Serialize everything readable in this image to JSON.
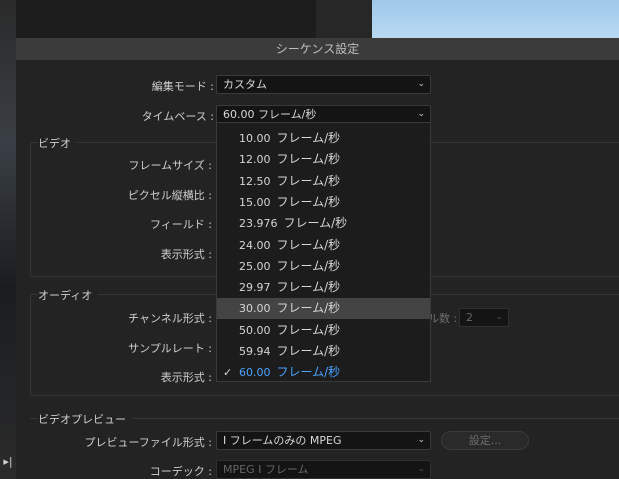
{
  "dialog": {
    "title": "シーケンス設定"
  },
  "edit_mode": {
    "label": "編集モード :",
    "value": "カスタム"
  },
  "timebase": {
    "label": "タイムベース :",
    "value": "60.00  フレーム/秒"
  },
  "video": {
    "title": "ビデオ",
    "frame_size_label": "フレームサイズ :",
    "pixel_aspect_label": "ピクセル縦横比 :",
    "field_label": "フィールド :",
    "display_format_label": "表示形式 :"
  },
  "audio": {
    "title": "オーディオ",
    "channel_format_label": "チャンネル形式 :",
    "channels_label": "ル数 :",
    "channels_value": "2",
    "sample_rate_label": "サンプルレート :",
    "display_format_label": "表示形式 :"
  },
  "preview": {
    "title": "ビデオプレビュー",
    "file_format_label": "プレビューファイル形式 :",
    "file_format_value": "I フレームのみの MPEG",
    "settings_button": "設定...",
    "codec_label": "コーデック :",
    "codec_value": "MPEG I フレーム"
  },
  "dropdown_items": [
    {
      "num": "10.00",
      "unit": "フレーム/秒",
      "state": ""
    },
    {
      "num": "12.00",
      "unit": "フレーム/秒",
      "state": ""
    },
    {
      "num": "12.50",
      "unit": "フレーム/秒",
      "state": ""
    },
    {
      "num": "15.00",
      "unit": "フレーム/秒",
      "state": ""
    },
    {
      "num": "23.976",
      "unit": "フレーム/秒",
      "state": ""
    },
    {
      "num": "24.00",
      "unit": "フレーム/秒",
      "state": ""
    },
    {
      "num": "25.00",
      "unit": "フレーム/秒",
      "state": ""
    },
    {
      "num": "29.97",
      "unit": "フレーム/秒",
      "state": ""
    },
    {
      "num": "30.00",
      "unit": "フレーム/秒",
      "state": "hover"
    },
    {
      "num": "50.00",
      "unit": "フレーム/秒",
      "state": ""
    },
    {
      "num": "59.94",
      "unit": "フレーム/秒",
      "state": ""
    },
    {
      "num": "60.00",
      "unit": "フレーム/秒",
      "state": "selected"
    }
  ],
  "icons": {
    "chevron": "chevron-down-icon",
    "check": "checkmark-icon"
  },
  "colors": {
    "selected_text": "#4aa3ff",
    "hover_bg": "#444444"
  }
}
